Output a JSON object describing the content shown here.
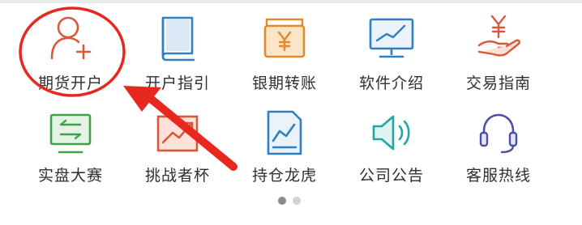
{
  "menu": {
    "items": [
      {
        "label": "期货开户",
        "icon": "person-add-icon",
        "color": "#d9583a"
      },
      {
        "label": "开户指引",
        "icon": "book-icon",
        "color": "#2f7fc1"
      },
      {
        "label": "银期转账",
        "icon": "yen-wallet-icon",
        "color": "#e08a2c"
      },
      {
        "label": "软件介绍",
        "icon": "monitor-chart-icon",
        "color": "#2f7fc1"
      },
      {
        "label": "交易指南",
        "icon": "yen-hand-icon",
        "color": "#d9583a"
      },
      {
        "label": "实盘大赛",
        "icon": "exchange-monitor-icon",
        "color": "#3fa14a"
      },
      {
        "label": "挑战者杯",
        "icon": "trend-up-icon",
        "color": "#d9583a"
      },
      {
        "label": "持仓龙虎",
        "icon": "chart-document-icon",
        "color": "#2f7fc1"
      },
      {
        "label": "公司公告",
        "icon": "speaker-icon",
        "color": "#1fa7a0"
      },
      {
        "label": "客服热线",
        "icon": "headset-icon",
        "color": "#4a4fa3"
      }
    ]
  },
  "pagination": {
    "pages": 2,
    "current": 1
  },
  "annotation": {
    "color": "#e8271f",
    "highlighted_item": "期货开户"
  }
}
